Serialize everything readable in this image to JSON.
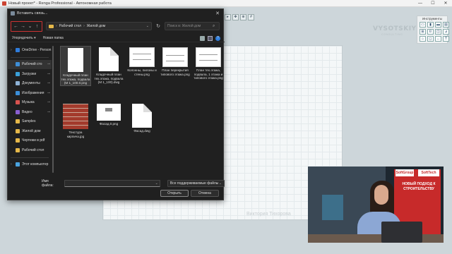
{
  "app": {
    "title": "Новый проект* - Renga Professional - Автономная работа",
    "controls": [
      "—",
      "☐",
      "✕"
    ]
  },
  "brand": {
    "name": "VYSOTSKIY",
    "sub": "CONSULTING"
  },
  "tools_panel": {
    "title": "Инструменты"
  },
  "canvas": {
    "caption": "Виктория Тихорова",
    "left_watermark": "..."
  },
  "video": {
    "logo1": "SoftGroup",
    "logo2": "SoftTech",
    "banner_text": "НОВЫЙ ПОДХОД К СТРОИТЕЛЬСТВУ"
  },
  "dialog": {
    "title": "Вставить связь...",
    "close": "✕",
    "address": {
      "crumbs": [
        "Рабочий стол",
        "Жилой дом"
      ]
    },
    "search": {
      "placeholder": "Поиск в: Жилой дом"
    },
    "commands": {
      "organize": "Упорядочить ▾",
      "new_folder": "Новая папка"
    },
    "sidebar": [
      {
        "label": "OneDrive - Person",
        "color": "#2f7ddc",
        "chev": "›",
        "pin": ""
      },
      {
        "label": "Рабочий сто",
        "color": "#3e8ed6",
        "chev": "",
        "pin": "📌",
        "selected": true
      },
      {
        "label": "Загрузки",
        "color": "#3aa0d8",
        "chev": "",
        "pin": "📌"
      },
      {
        "label": "Документы",
        "color": "#8fb3d6",
        "chev": "",
        "pin": "📌"
      },
      {
        "label": "Изображения",
        "color": "#3b8fd9",
        "chev": "",
        "pin": "📌"
      },
      {
        "label": "Музыка",
        "color": "#d9534f",
        "chev": "",
        "pin": "📌"
      },
      {
        "label": "Видео",
        "color": "#8a5fd0",
        "chev": "",
        "pin": "📌"
      },
      {
        "label": "Samples",
        "color": "#e5b84a",
        "chev": "",
        "pin": ""
      },
      {
        "label": "Жилой дом",
        "color": "#e5b84a",
        "chev": "",
        "pin": ""
      },
      {
        "label": "Чертежи в pdf",
        "color": "#e5b84a",
        "chev": "",
        "pin": ""
      },
      {
        "label": "Рабочий стол",
        "color": "#e5b84a",
        "chev": "",
        "pin": ""
      },
      {
        "label": "Этот компьютер",
        "color": "#4aa3df",
        "chev": "›",
        "pin": ""
      }
    ],
    "files": [
      {
        "name": "Кладочный план тех.этажа, подвала (М 1_100.0.png",
        "kind": "png",
        "selected": true
      },
      {
        "name": "Кладочный план тех.этажа, подвала (М 1_100).dwg",
        "kind": "doc"
      },
      {
        "name": "Колонны, пилоны и стены.png",
        "kind": "png"
      },
      {
        "name": "План перекрытия типового этажа.png",
        "kind": "png"
      },
      {
        "name": "План тех.этажа, подвала, 1 этажа и типового этажа.png",
        "kind": "png"
      },
      {
        "name": "Текстура кирпича.jpg",
        "kind": "brick"
      },
      {
        "name": "Фасад.0.png",
        "kind": "facade"
      },
      {
        "name": "Фасад.dwg",
        "kind": "doc"
      }
    ],
    "filename_label": "Имя файла:",
    "filename_value": "",
    "filter": "Все поддерживаемые файлы",
    "open": "Открыть",
    "cancel": "Отмена"
  }
}
